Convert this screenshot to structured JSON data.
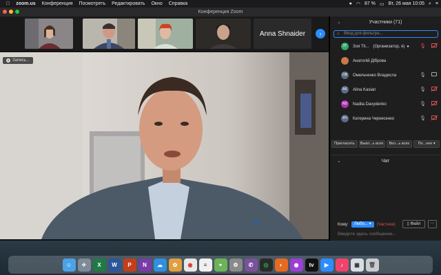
{
  "menubar": {
    "app": "zoom.us",
    "items": [
      "Конференция",
      "Посмотреть",
      "Редактировать",
      "Окно",
      "Справка"
    ],
    "battery": "87 %",
    "datetime": "Вт, 26 мая  10:05"
  },
  "window": {
    "title": "Конференция Zoom"
  },
  "thumbnails": {
    "name_tile": "Anna Shnaider"
  },
  "recording": {
    "label": "Запись..."
  },
  "participants": {
    "header": "Участники (71)",
    "search_placeholder": "Ввод для фильтра...",
    "list": [
      {
        "initials": "ЗТ",
        "name": "Зоя Tit...",
        "role": "(Организатор, я)",
        "color": "#2fa86a",
        "mic": "muted",
        "cam": "off"
      },
      {
        "initials": "",
        "name": "Анатолій Діброва",
        "role": "",
        "color": "#c87a4a",
        "mic": "on",
        "cam": "on"
      },
      {
        "initials": "ОВ",
        "name": "Омельченко Владисла",
        "role": "",
        "color": "#5a6d85",
        "mic": "on",
        "cam": "on"
      },
      {
        "initials": "AK",
        "name": "Alina Kasian",
        "role": "",
        "color": "#5a6d85",
        "mic": "on",
        "cam": "off"
      },
      {
        "initials": "ND",
        "name": "Nadiia Davydenko",
        "role": "",
        "color": "#b030b0",
        "mic": "on",
        "cam": "off"
      },
      {
        "initials": "КЧ",
        "name": "Катерина Черкесенко",
        "role": "",
        "color": "#5a6d85",
        "mic": "on",
        "cam": "off"
      }
    ],
    "buttons": [
      "Пригласить",
      "Выкл...ь всех",
      "Вкл...ь всех",
      "По...нее ▾"
    ]
  },
  "chat": {
    "header": "Чат",
    "to_label": "Кому:",
    "to_value": "Любо... ▾",
    "private": "(Частное)",
    "file_button": "Файл",
    "more_button": "···",
    "placeholder": "Введите здесь сообщение..."
  },
  "dock": [
    "finder",
    "launchpad",
    "excel",
    "word",
    "powerpoint",
    "onenote",
    "onedrive",
    "photos",
    "chrome",
    "notes",
    "maps",
    "settings",
    "viber",
    "spotify",
    "firefox",
    "podcasts",
    "tv",
    "zoom",
    "music",
    "preview",
    "trash"
  ]
}
